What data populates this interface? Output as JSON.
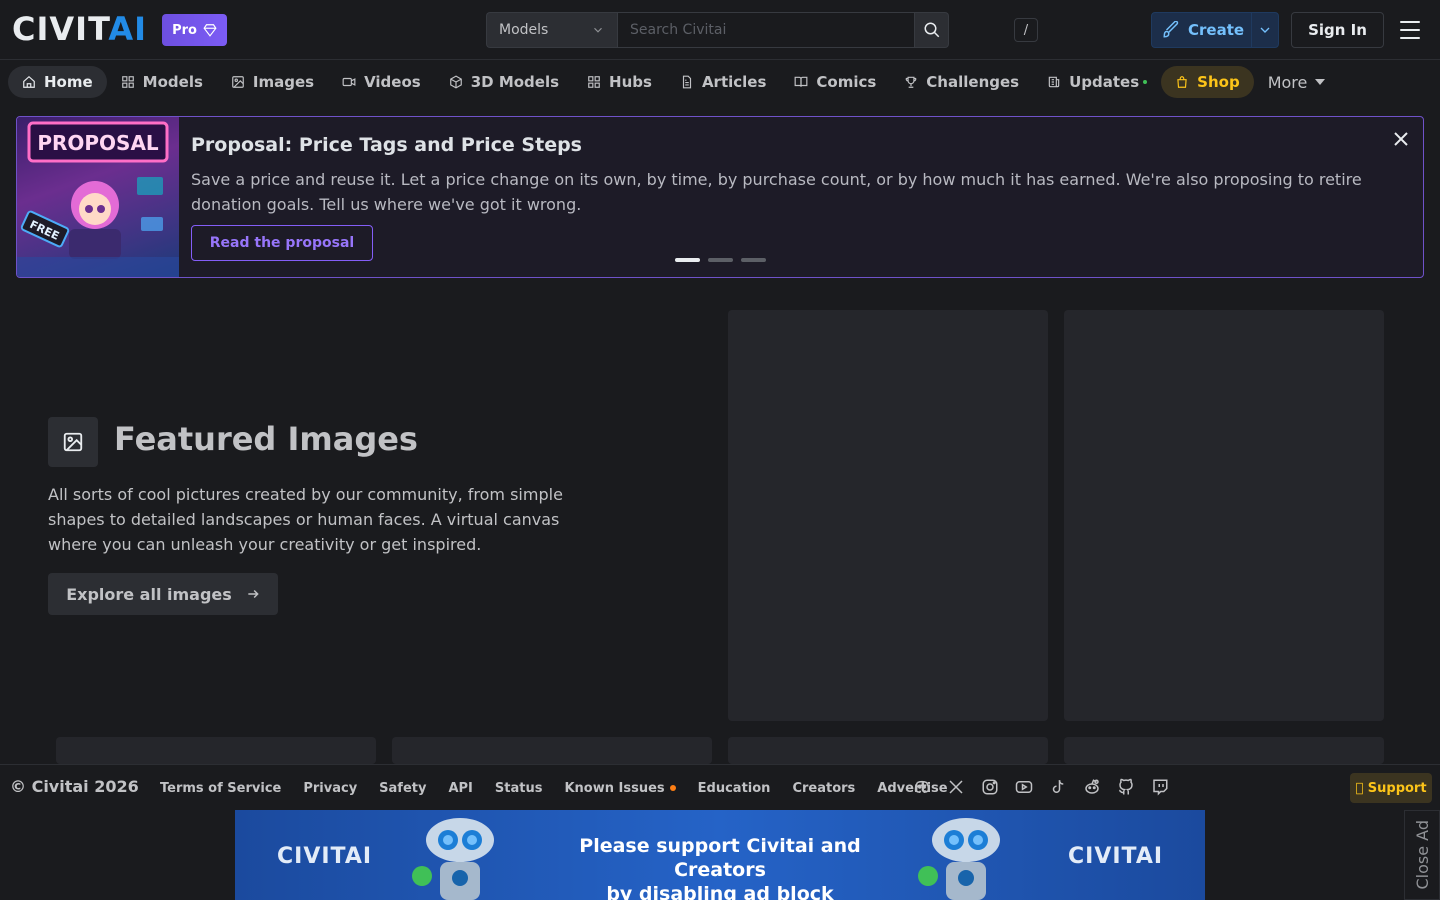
{
  "header": {
    "logo_main": "CIVIT",
    "logo_accent": "AI",
    "pro_label": "Pro",
    "search": {
      "scope": "Models",
      "placeholder": "Search Civitai",
      "shortcut": "/"
    },
    "create_label": "Create",
    "signin_label": "Sign In"
  },
  "nav": {
    "items": [
      {
        "label": "Home",
        "icon": "home-icon"
      },
      {
        "label": "Models",
        "icon": "grid-icon"
      },
      {
        "label": "Images",
        "icon": "image-icon"
      },
      {
        "label": "Videos",
        "icon": "video-icon"
      },
      {
        "label": "3D Models",
        "icon": "cube-icon"
      },
      {
        "label": "Hubs",
        "icon": "grid-icon"
      },
      {
        "label": "Articles",
        "icon": "file-icon"
      },
      {
        "label": "Comics",
        "icon": "book-icon"
      },
      {
        "label": "Challenges",
        "icon": "trophy-icon"
      },
      {
        "label": "Updates",
        "icon": "news-icon"
      },
      {
        "label": "Shop",
        "icon": "bag-icon"
      }
    ],
    "more_label": "More"
  },
  "banner": {
    "image_text_top": "PROPOSAL",
    "image_text_free": "FREE",
    "title": "Proposal: Price Tags and Price Steps",
    "text": "Save a price and reuse it. Let a price change on its own, by time, by purchase count, or by how much it has earned. We're also proposing to retire donation goals. Tell us where we've got it wrong.",
    "button": "Read the proposal",
    "slides": 3,
    "active_slide": 1
  },
  "featured": {
    "title": "Featured Images",
    "description": "All sorts of cool pictures created by our community, from simple shapes to detailed landscapes or human faces. A virtual canvas where you can unleash your creativity or get inspired.",
    "button": "Explore all images"
  },
  "footer": {
    "copyright": "© Civitai 2026",
    "links": [
      "Terms of Service",
      "Privacy",
      "Safety",
      "API",
      "Status",
      "Known Issues",
      "Education",
      "Creators",
      "Advertise"
    ],
    "socials": [
      "discord-icon",
      "x-icon",
      "instagram-icon",
      "youtube-icon",
      "tiktok-icon",
      "reddit-icon",
      "github-icon",
      "twitch-icon"
    ],
    "support_label": "\u0000 Support"
  },
  "ad": {
    "logo": "CIVITAI",
    "line1": "Please support Civitai and Creators",
    "line2": "by disabling ad block",
    "close_label": "Close Ad"
  },
  "colors": {
    "background": "#1a1b1e",
    "accent_blue": "#228be6",
    "pro_purple": "#7c5cf5",
    "shop_yellow": "#fcc419",
    "banner_border": "#6f52c9"
  }
}
